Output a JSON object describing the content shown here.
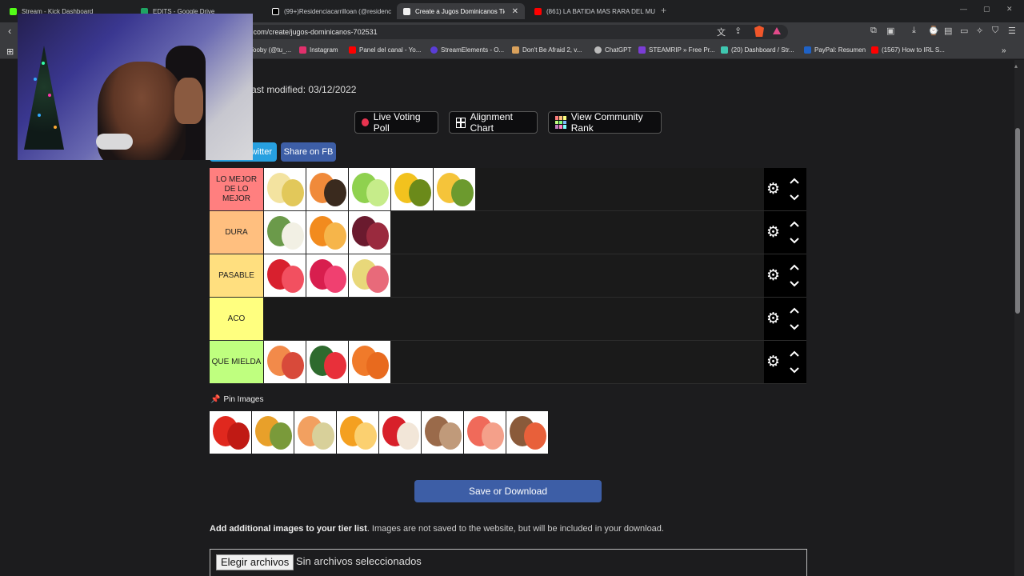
{
  "browser": {
    "tabs": [
      {
        "label": "Stream - Kick Dashboard",
        "color": "#53fc18"
      },
      {
        "label": "EDITS - Google Drive",
        "color": "#1fa463"
      },
      {
        "label": "(99+)Residenciacarrilloan (@residenc",
        "color": "#ffffff"
      },
      {
        "label": "Create a Jugos Dominicanos Tier",
        "color": "#f0f0f0"
      },
      {
        "label": "(861) LA BATIDA MAS RARA DEL MU",
        "color": "#ff0000"
      }
    ],
    "active_tab_index": 3,
    "url": "ker.com/create/jugos-dominicanos-702531",
    "bookmarks": [
      {
        "label": "Tooby (@tu_...",
        "color": "#444"
      },
      {
        "label": "Instagram",
        "color": "#e1306c"
      },
      {
        "label": "Panel del canal - Yo...",
        "color": "#ff0000"
      },
      {
        "label": "StreamElements - O...",
        "color": "#5a3dd6"
      },
      {
        "label": "Don't Be Afraid 2, v...",
        "color": "#d9a15c"
      },
      {
        "label": "ChatGPT",
        "color": "#bbbbbb"
      },
      {
        "label": "STEAMRIP » Free Pr...",
        "color": "#7b3dd6"
      },
      {
        "label": "(20) Dashboard / Str...",
        "color": "#3fc7b0"
      },
      {
        "label": "PayPal: Resumen",
        "color": "#1f62c6"
      },
      {
        "label": "(1567) How to IRL S...",
        "color": "#ff0000"
      }
    ]
  },
  "page": {
    "last_modified": "ast modified: 03/12/2022",
    "buttons": {
      "live_poll": "Live Voting Poll",
      "alignment": "Alignment Chart",
      "community_rank": "View Community Rank"
    },
    "share_twitter": "witter",
    "share_fb": "Share on FB",
    "tiers": [
      {
        "label": "LO MEJOR DE LO MEJOR",
        "color": "#ff7f7f",
        "items": [
          "banana",
          "papaya",
          "lime",
          "passion-fruit",
          "pineapple"
        ]
      },
      {
        "label": "DURA",
        "color": "#ffbf7f",
        "items": [
          "soursop",
          "orange",
          "grapes"
        ]
      },
      {
        "label": "PASABLE",
        "color": "#ffdf7f",
        "items": [
          "strawberry",
          "raspberry",
          "guava"
        ]
      },
      {
        "label": "ACO",
        "color": "#ffff7f",
        "items": []
      },
      {
        "label": "QUE MIELDA",
        "color": "#bfff7f",
        "items": [
          "peach",
          "watermelon",
          "carrot"
        ]
      }
    ],
    "pin_label": "Pin Images",
    "pinned": [
      "tomato",
      "mango",
      "cantaloupe",
      "orange-slices",
      "apple",
      "tamarind",
      "grapefruit",
      "mamey"
    ],
    "save_button": "Save or Download",
    "add_images_bold": "Add additional images to your tier list",
    "add_images_rest": ". Images are not saved to the website, but will be included in your download.",
    "file_button": "Elegir archivos",
    "file_status": "Sin archivos seleccionados"
  },
  "fruit_colors": {
    "banana": [
      "#f3e3a0",
      "#e2c85a"
    ],
    "papaya": [
      "#f08a3a",
      "#3a2a1e"
    ],
    "lime": [
      "#8fd14f",
      "#c6ec8a"
    ],
    "passion-fruit": [
      "#f2c21e",
      "#6b8a1a"
    ],
    "pineapple": [
      "#f5c43a",
      "#6c9a2e"
    ],
    "soursop": [
      "#6b9a4a",
      "#f2f0e4"
    ],
    "orange": [
      "#f28b1e",
      "#f6b54a"
    ],
    "grapes": [
      "#6a1a2e",
      "#9a2a3e"
    ],
    "strawberry": [
      "#d8202e",
      "#f25060"
    ],
    "raspberry": [
      "#d81e4e",
      "#f04070"
    ],
    "guava": [
      "#e8d87a",
      "#e86a7a"
    ],
    "peach": [
      "#f28a4a",
      "#d84a3a"
    ],
    "watermelon": [
      "#2e6a2e",
      "#e8303a"
    ],
    "carrot": [
      "#f07a2a",
      "#e86a1e"
    ],
    "tomato": [
      "#e0281e",
      "#c01a14"
    ],
    "mango": [
      "#e8a02a",
      "#7a9a3a"
    ],
    "cantaloupe": [
      "#f2a060",
      "#d8d09a"
    ],
    "orange-slices": [
      "#f4a020",
      "#fbd070"
    ],
    "apple": [
      "#d8202a",
      "#f2e6d8"
    ],
    "tamarind": [
      "#9a6a4a",
      "#c09a7a"
    ],
    "grapefruit": [
      "#f06a5a",
      "#f4a08a"
    ],
    "mamey": [
      "#8a5a3a",
      "#e8603a"
    ]
  }
}
